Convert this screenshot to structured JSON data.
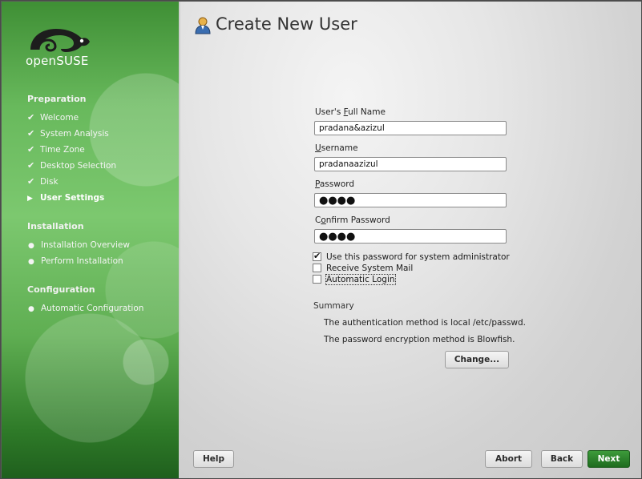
{
  "sidebar": {
    "logo_text": "openSUSE",
    "sections": [
      {
        "title": "Preparation"
      },
      {
        "title": "Installation"
      },
      {
        "title": "Configuration"
      }
    ],
    "steps": [
      {
        "label": "Welcome",
        "state": "done"
      },
      {
        "label": "System Analysis",
        "state": "done"
      },
      {
        "label": "Time Zone",
        "state": "done"
      },
      {
        "label": "Desktop Selection",
        "state": "done"
      },
      {
        "label": "Disk",
        "state": "done"
      },
      {
        "label": "User Settings",
        "state": "current"
      },
      {
        "label": "Installation Overview",
        "state": "pending"
      },
      {
        "label": "Perform Installation",
        "state": "pending"
      },
      {
        "label": "Automatic Configuration",
        "state": "pending"
      }
    ]
  },
  "main": {
    "title": "Create New User",
    "full_name_label": "User's Full Name",
    "full_name_value": "pradana&azizul",
    "username_label": "Username",
    "username_value": "pradanaazizul",
    "password_label": "Password",
    "password_dots": "●●●●",
    "confirm_label": "Confirm Password",
    "confirm_dots": "●●●●",
    "checkboxes": [
      {
        "label": "Use this password for system administrator",
        "checked": true
      },
      {
        "label": "Receive System Mail",
        "checked": false
      },
      {
        "label": "Automatic Login",
        "checked": false
      }
    ],
    "summary_title": "Summary",
    "summary_lines": [
      "The authentication method is local /etc/passwd.",
      "The password encryption method is Blowfish."
    ],
    "change_button": "Change..."
  },
  "footer": {
    "help": "Help",
    "abort": "Abort",
    "back": "Back",
    "next": "Next"
  },
  "colors": {
    "accent_green": "#2e7d2a",
    "sidebar_green": "#68b95c"
  }
}
